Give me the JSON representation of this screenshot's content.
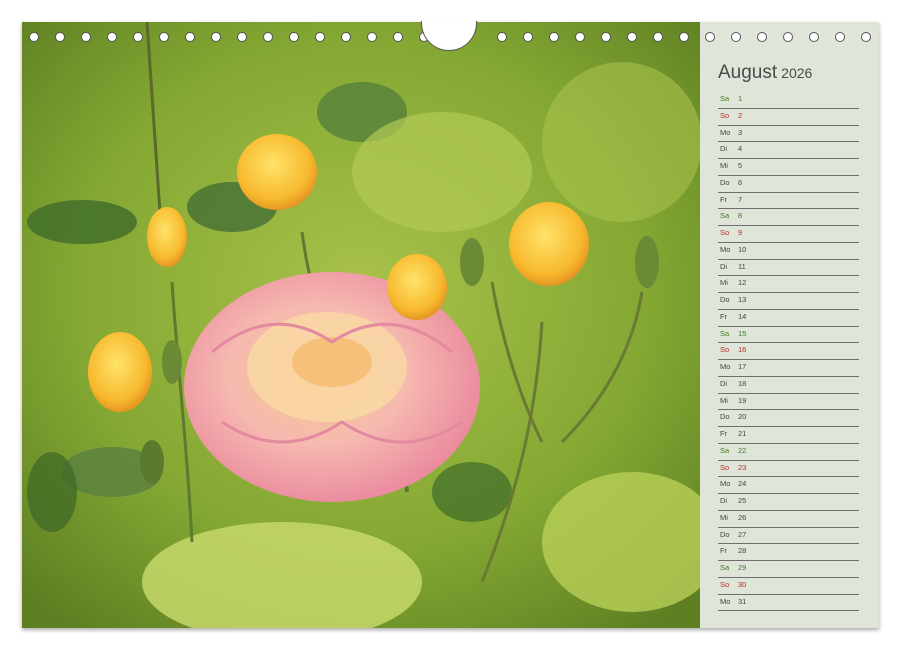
{
  "calendar": {
    "month": "August",
    "year": "2026",
    "days": [
      {
        "wd": "Sa",
        "d": "1",
        "type": "sat"
      },
      {
        "wd": "So",
        "d": "2",
        "type": "sun"
      },
      {
        "wd": "Mo",
        "d": "3",
        "type": "wk"
      },
      {
        "wd": "Di",
        "d": "4",
        "type": "wk"
      },
      {
        "wd": "Mi",
        "d": "5",
        "type": "wk"
      },
      {
        "wd": "Do",
        "d": "6",
        "type": "wk"
      },
      {
        "wd": "Fr",
        "d": "7",
        "type": "wk"
      },
      {
        "wd": "Sa",
        "d": "8",
        "type": "sat"
      },
      {
        "wd": "So",
        "d": "9",
        "type": "sun"
      },
      {
        "wd": "Mo",
        "d": "10",
        "type": "wk"
      },
      {
        "wd": "Di",
        "d": "11",
        "type": "wk"
      },
      {
        "wd": "Mi",
        "d": "12",
        "type": "wk"
      },
      {
        "wd": "Do",
        "d": "13",
        "type": "wk"
      },
      {
        "wd": "Fr",
        "d": "14",
        "type": "wk"
      },
      {
        "wd": "Sa",
        "d": "15",
        "type": "sat"
      },
      {
        "wd": "So",
        "d": "16",
        "type": "sun"
      },
      {
        "wd": "Mo",
        "d": "17",
        "type": "wk"
      },
      {
        "wd": "Di",
        "d": "18",
        "type": "wk"
      },
      {
        "wd": "Mi",
        "d": "19",
        "type": "wk"
      },
      {
        "wd": "Do",
        "d": "20",
        "type": "wk"
      },
      {
        "wd": "Fr",
        "d": "21",
        "type": "wk"
      },
      {
        "wd": "Sa",
        "d": "22",
        "type": "sat"
      },
      {
        "wd": "So",
        "d": "23",
        "type": "sun"
      },
      {
        "wd": "Mo",
        "d": "24",
        "type": "wk"
      },
      {
        "wd": "Di",
        "d": "25",
        "type": "wk"
      },
      {
        "wd": "Mi",
        "d": "26",
        "type": "wk"
      },
      {
        "wd": "Do",
        "d": "27",
        "type": "wk"
      },
      {
        "wd": "Fr",
        "d": "28",
        "type": "wk"
      },
      {
        "wd": "Sa",
        "d": "29",
        "type": "sat"
      },
      {
        "wd": "So",
        "d": "30",
        "type": "sun"
      },
      {
        "wd": "Mo",
        "d": "31",
        "type": "wk"
      }
    ]
  },
  "colors": {
    "saturday": "#3d7a22",
    "sunday": "#c0281c",
    "weekday": "#444444",
    "panel": "#e0e5da"
  },
  "photo": {
    "subject_icon": "rose-photo-icon"
  }
}
